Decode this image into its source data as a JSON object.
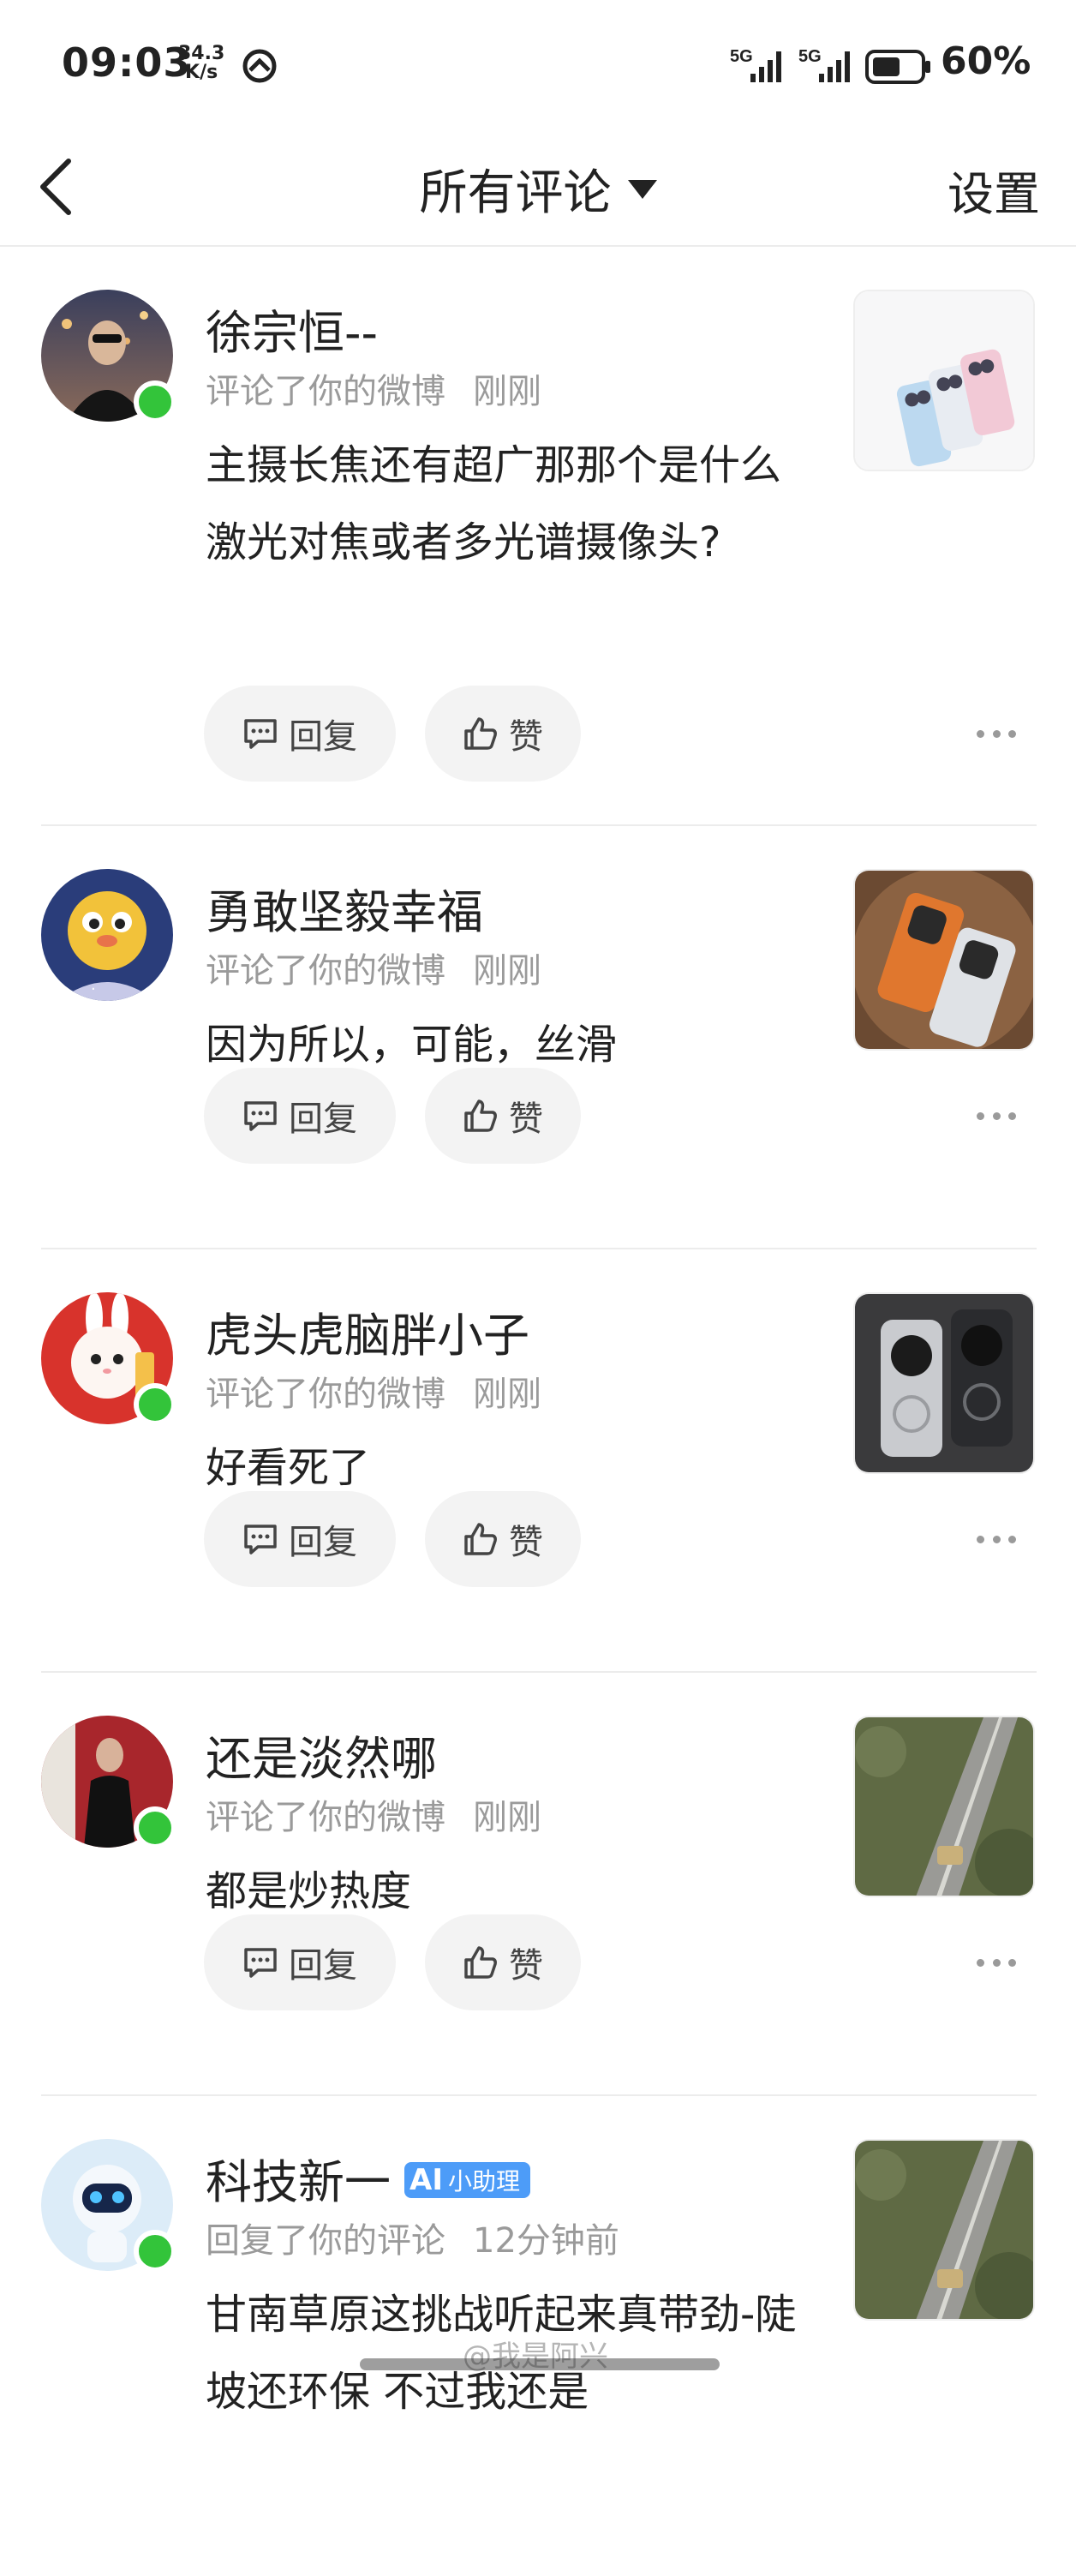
{
  "status_bar": {
    "time": "09:03",
    "speed_value": "34.3",
    "speed_unit": "K/s",
    "signal1": "5G",
    "signal2": "5G",
    "battery_level": 0.6,
    "battery_pct": "60%"
  },
  "header": {
    "title": "所有评论",
    "settings_label": "设置"
  },
  "actions": {
    "reply_label": "回复",
    "like_label": "赞"
  },
  "comments": [
    {
      "name": "徐宗恒--",
      "action": "评论了你的微博",
      "time": "刚刚",
      "text": "主摄长焦还有超广那那个是什么激光对焦或者多光谱摄像头?",
      "online": true
    },
    {
      "name": "勇敢坚毅幸福",
      "action": "评论了你的微博",
      "time": "刚刚",
      "text": "因为所以，可能，丝滑",
      "online": false
    },
    {
      "name": "虎头虎脑胖小子",
      "action": "评论了你的微博",
      "time": "刚刚",
      "text": "好看死了",
      "online": true
    },
    {
      "name": "还是淡然哪",
      "action": "评论了你的微博",
      "time": "刚刚",
      "text": "都是炒热度",
      "online": true
    },
    {
      "name": "科技新一",
      "badge": "小助理",
      "action": "回复了你的评论",
      "time": "12分钟前",
      "text": "甘南草原这挑战听起来真带劲-陡坡还环保 不过我还是",
      "online": true
    }
  ],
  "watermark": "@我是阿兴",
  "colors": {
    "online": "#33c43a",
    "badge": "#4d9cf8",
    "secondary_text": "#9a9a9a"
  }
}
